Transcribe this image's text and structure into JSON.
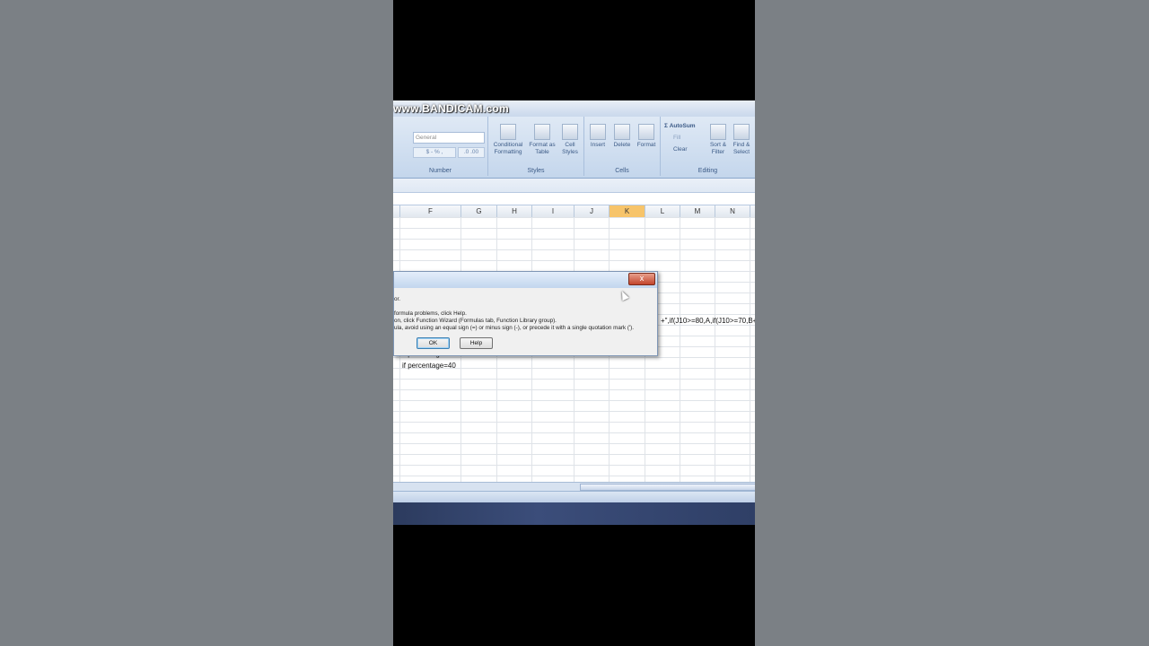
{
  "watermark": "www.BANDICAM.com",
  "ribbon": {
    "number_format": "General",
    "number_buttons": [
      "$ - % ,",
      ".0 .00"
    ],
    "number_group": "Number",
    "styles": {
      "conditional": "Conditional Formatting",
      "format_table": "Format as Table",
      "cell_styles": "Cell Styles",
      "group": "Styles"
    },
    "cells": {
      "insert": "Insert",
      "delete": "Delete",
      "format": "Format",
      "group": "Cells"
    },
    "editing": {
      "autosum": "Σ AutoSum",
      "fill": "Fill",
      "clear": "Clear",
      "sort_filter": "Sort & Filter",
      "find_select": "Find & Select",
      "group": "Editing"
    }
  },
  "columns": [
    "F",
    "G",
    "H",
    "I",
    "J",
    "K",
    "L",
    "M",
    "N"
  ],
  "selected_column": "K",
  "cells": {
    "formula_fragment": "+\",if(J10>=80,A,if(J10>=70,B+",
    "partial_text": "if percentage=50",
    "percentage_line": "if percentage=40"
  },
  "dialog": {
    "line1": "or.",
    "line2": "formula problems, click Help.",
    "line3": "on, click Function Wizard (Formulas tab, Function Library group).",
    "line4": "ula, avoid using an equal sign (=) or minus sign (-), or precede it with a single quotation mark (').",
    "ok_label": "OK",
    "help_label": "Help",
    "close_label": "x"
  },
  "colors": {
    "selected_column_header": "#f7c46a",
    "ribbon": "#c4d6ec"
  }
}
